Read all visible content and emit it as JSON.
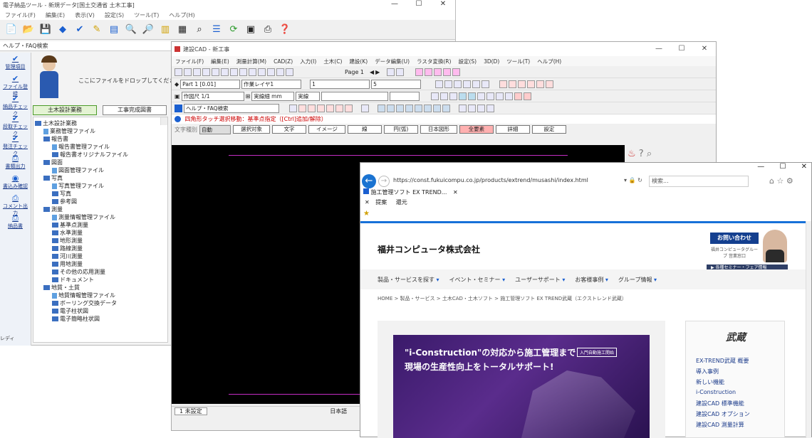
{
  "win1": {
    "title": "電子納品ツール - 新規データ[国土交通省 土木工事]",
    "menu": [
      "ファイル(F)",
      "編集(E)",
      "表示(V)",
      "設定(S)",
      "ツール(T)",
      "ヘルプ(H)"
    ],
    "help_header": "ヘルプ・FAQ検索",
    "guide_text": "ここにファイルをドロップしてください",
    "sidebar": [
      {
        "label": "管理項目",
        "icon": "check-icon"
      },
      {
        "label": "ファイル登録",
        "icon": "check-icon"
      },
      {
        "label": "納品チェック",
        "icon": "check-icon"
      },
      {
        "label": "段取チェック",
        "icon": "check-icon"
      },
      {
        "label": "発注チェック",
        "icon": "check-icon"
      },
      {
        "label": "書類出力",
        "icon": "printer-icon"
      },
      {
        "label": "書込み確認",
        "icon": "disc-icon"
      },
      {
        "label": "コメント出力",
        "icon": "printer-icon"
      },
      {
        "label": "納品書",
        "icon": "printer-icon"
      }
    ],
    "tabs": [
      "土木設計業務",
      "工事完成図書"
    ],
    "tree": [
      {
        "depth": 0,
        "kind": "folder",
        "label": "土木設計業務"
      },
      {
        "depth": 1,
        "kind": "doc",
        "label": "業務管理ファイル"
      },
      {
        "depth": 1,
        "kind": "folder",
        "label": "報告書"
      },
      {
        "depth": 2,
        "kind": "doc",
        "label": "報告書管理ファイル"
      },
      {
        "depth": 2,
        "kind": "folder",
        "label": "報告書オリジナルファイル"
      },
      {
        "depth": 1,
        "kind": "folder",
        "label": "図面"
      },
      {
        "depth": 2,
        "kind": "doc",
        "label": "図面管理ファイル"
      },
      {
        "depth": 1,
        "kind": "folder",
        "label": "写真"
      },
      {
        "depth": 2,
        "kind": "doc",
        "label": "写真管理ファイル"
      },
      {
        "depth": 2,
        "kind": "folder",
        "label": "写真"
      },
      {
        "depth": 2,
        "kind": "folder",
        "label": "参考図"
      },
      {
        "depth": 1,
        "kind": "folder",
        "label": "測量"
      },
      {
        "depth": 2,
        "kind": "doc",
        "label": "測量情報管理ファイル"
      },
      {
        "depth": 2,
        "kind": "folder",
        "label": "基準点測量"
      },
      {
        "depth": 2,
        "kind": "folder",
        "label": "水準測量"
      },
      {
        "depth": 2,
        "kind": "folder",
        "label": "地形測量"
      },
      {
        "depth": 2,
        "kind": "folder",
        "label": "路線測量"
      },
      {
        "depth": 2,
        "kind": "folder",
        "label": "河川測量"
      },
      {
        "depth": 2,
        "kind": "folder",
        "label": "用地測量"
      },
      {
        "depth": 2,
        "kind": "folder",
        "label": "その他の応用測量"
      },
      {
        "depth": 2,
        "kind": "folder",
        "label": "ドキュメント"
      },
      {
        "depth": 1,
        "kind": "folder",
        "label": "地質・土質"
      },
      {
        "depth": 2,
        "kind": "doc",
        "label": "地質情報管理ファイル"
      },
      {
        "depth": 2,
        "kind": "folder",
        "label": "ボーリング交換データ"
      },
      {
        "depth": 2,
        "kind": "folder",
        "label": "電子柱状図"
      },
      {
        "depth": 2,
        "kind": "folder",
        "label": "電子簡略柱状図"
      }
    ],
    "status": "レディ"
  },
  "win2": {
    "title": "建設CAD - 新工事",
    "menu": [
      "ファイル(F)",
      "編集(E)",
      "測量計算(M)",
      "CAD(Z)",
      "入力(I)",
      "土木(C)",
      "建設(K)",
      "データ編集(U)",
      "ラスタ変換(R)",
      "設定(S)",
      "3D(D)",
      "ツール(T)",
      "ヘルプ(H)"
    ],
    "layer_combo": "Part 1 [0.01]",
    "work_combo": "作業レイヤ1",
    "num_combo": "1",
    "num_combo2": "5",
    "scale_combo": "作図尺 1/1",
    "line_combo": "実線細 mm",
    "color_combo": "実線",
    "page_label": "Page 1",
    "help_search": "ヘルプ・FAQ検索",
    "notice": "四角形タッチ選択移動：基準点指定（[Ctrl]追加/解除）",
    "sel_label": "文字種別",
    "sel_mode": "自動",
    "sel_buttons": [
      "選択対象",
      "文字",
      "イメージ",
      "線",
      "円(弧)",
      "日本図形",
      "全要素",
      "詳細",
      "設定"
    ],
    "sel_hilite_index": 6,
    "bottom_tab": "1 未設定",
    "bottom_label": "日本語"
  },
  "win3": {
    "url": "https://const.fukuicompu.co.jp/products/extrend/musashi/index.html",
    "search_placeholder": "検索...",
    "tab_label": "施工管理ソフト EX TREND...",
    "fav": [
      "提案",
      "還元"
    ],
    "company": "福井コンピュータ株式会社",
    "contact_btn": "お問い合わせ",
    "contact_sub": "福井コンピュータグループ 営業窓口",
    "seminar": "▶ 各種セミナー・フェア情報",
    "nav": [
      "製品・サービスを探す",
      "イベント・セミナー",
      "ユーザーサポート",
      "お客様事例",
      "グループ情報"
    ],
    "breadcrumb": "HOME > 製品・サービス > 土木CAD・土木ソフト > 施工管理ソフト EX TREND武蔵（エクストレンド武蔵）",
    "banner_line1": "\"i-Construction\"の対応から施工管理まで",
    "banner_line2": "現場の生産性向上をトータルサポート!",
    "banner_badge": "入門自動施工開始",
    "side_logo": "武蔵",
    "side_items": [
      "EX-TREND武蔵 概要",
      "導入事例",
      "新しい機能",
      "i-Construction",
      "建設CAD 標準機能",
      "建設CAD オプション",
      "建設CAD 測量計算"
    ],
    "colors": {
      "brand": "#1771d8",
      "purple": "#5a2c8c"
    }
  }
}
